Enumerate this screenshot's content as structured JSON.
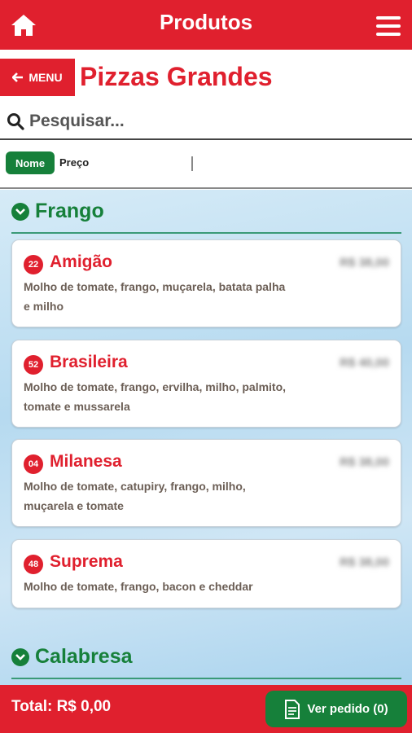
{
  "header": {
    "title": "Produtos",
    "home_icon": "home-icon",
    "menu_icon": "hamburger-icon"
  },
  "category": {
    "back_label": "MENU",
    "title": "Pizzas Grandes"
  },
  "search": {
    "placeholder": "Pesquisar..."
  },
  "sort": {
    "nome_label": "Nome",
    "preco_label": "Preço"
  },
  "sections": [
    {
      "name": "Frango",
      "items": [
        {
          "code": "22",
          "name": "Amigão",
          "price": "R$ 38,00",
          "desc": "Molho de tomate, frango, muçarela, batata palha e milho"
        },
        {
          "code": "52",
          "name": "Brasileira",
          "price": "R$ 40,00",
          "desc": "Molho de tomate, frango, ervilha, milho, palmito, tomate e mussarela"
        },
        {
          "code": "04",
          "name": "Milanesa",
          "price": "R$ 38,00",
          "desc": "Molho de tomate, catupiry, frango, milho, muçarela e tomate"
        },
        {
          "code": "48",
          "name": "Suprema",
          "price": "R$ 38,00",
          "desc": "Molho de tomate, frango, bacon e cheddar"
        }
      ]
    },
    {
      "name": "Calabresa",
      "items": []
    }
  ],
  "footer": {
    "total_label": "Total: R$ 0,00",
    "order_button": "Ver pedido (0)"
  },
  "colors": {
    "brand_red": "#e0202e",
    "brand_green": "#16803a"
  }
}
